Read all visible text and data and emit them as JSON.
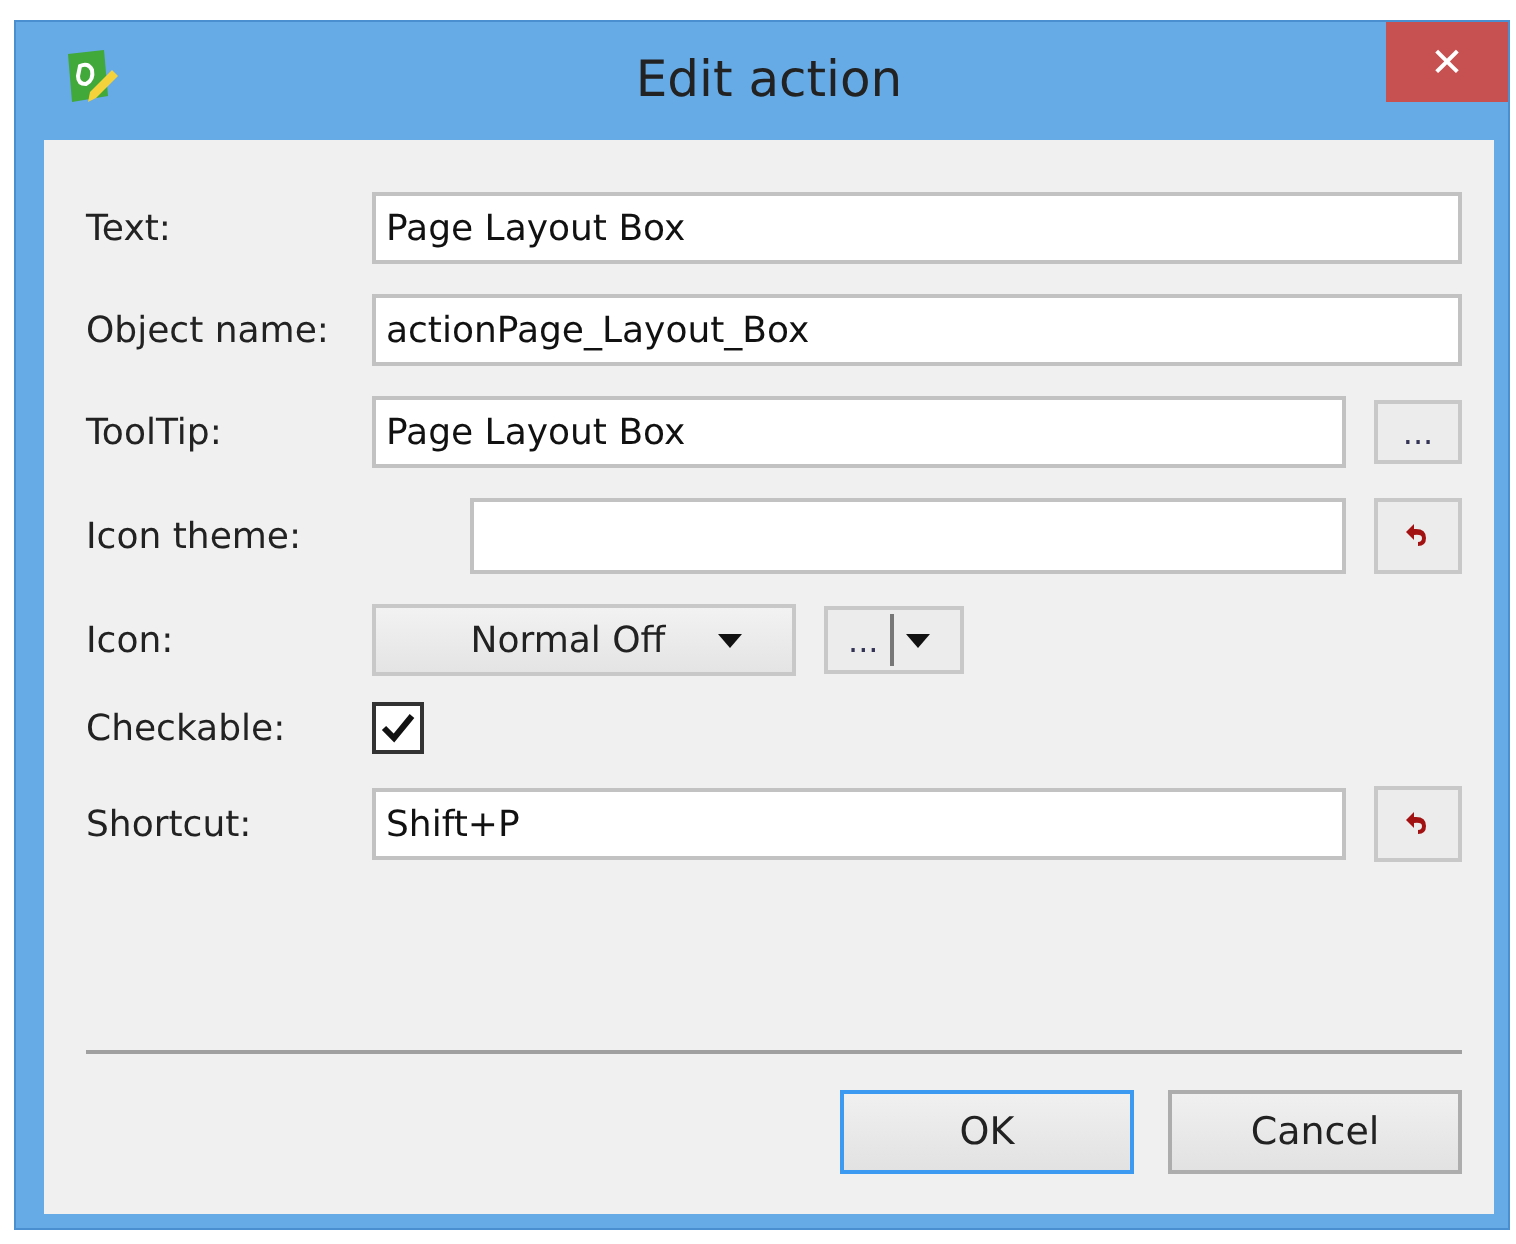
{
  "window": {
    "title": "Edit action",
    "close": "✕"
  },
  "rows": [
    {
      "kind": "text",
      "label": "Text:",
      "value": "Page Layout Box"
    },
    {
      "kind": "text",
      "label": "Object name:",
      "value": "actionPage_Layout_Box"
    },
    {
      "kind": "text_more",
      "label": "ToolTip:",
      "value": "Page Layout Box",
      "button": "..."
    },
    {
      "kind": "theme_reset",
      "label": "Icon theme:",
      "value": ""
    },
    {
      "kind": "icon",
      "label": "Icon:",
      "mode": "Normal Off",
      "button": "..."
    },
    {
      "kind": "checkbox",
      "label": "Checkable:",
      "checked": true
    },
    {
      "kind": "text_reset",
      "label": "Shortcut:",
      "value": "Shift+P"
    }
  ],
  "buttons": [
    {
      "label": "OK",
      "default": true
    },
    {
      "label": "Cancel",
      "default": false
    }
  ]
}
